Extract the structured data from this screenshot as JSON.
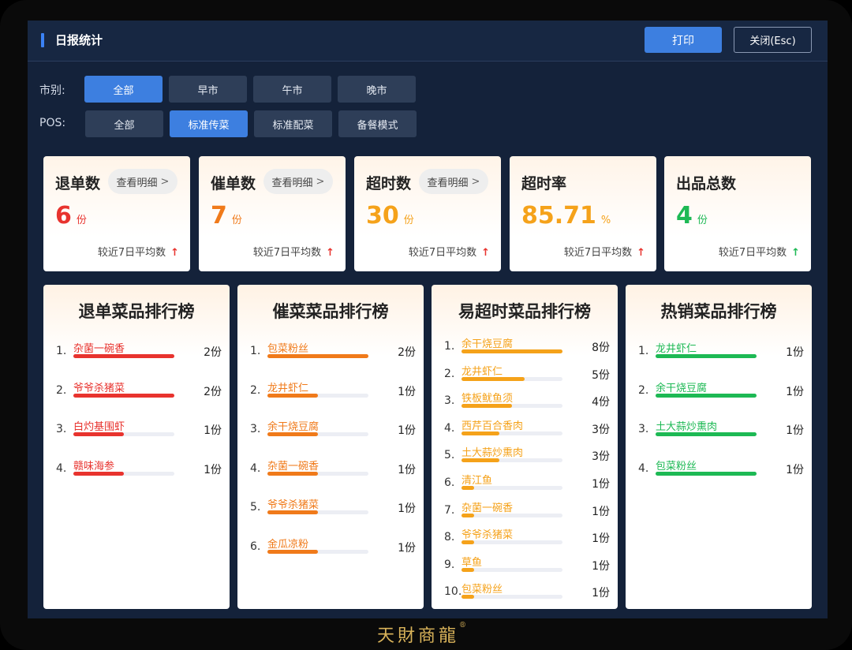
{
  "header": {
    "title": "日报统计",
    "print_label": "打印",
    "close_label": "关闭(Esc)"
  },
  "filters": {
    "market": {
      "label": "市别:",
      "options": [
        "全部",
        "早市",
        "午市",
        "晚市"
      ],
      "selected": 0
    },
    "pos": {
      "label": "POS:",
      "options": [
        "全部",
        "标准传菜",
        "标准配菜",
        "备餐模式"
      ],
      "selected": 1
    }
  },
  "stats": [
    {
      "title": "退单数",
      "detail": "查看明细",
      "value": "6",
      "unit": "份",
      "color": "#e8332e",
      "foot": "较近7日平均数",
      "trend": "up",
      "trend_color": "#e8332e"
    },
    {
      "title": "催单数",
      "detail": "查看明细",
      "value": "7",
      "unit": "份",
      "color": "#f07a1a",
      "foot": "较近7日平均数",
      "trend": "up",
      "trend_color": "#e8332e"
    },
    {
      "title": "超时数",
      "detail": "查看明细",
      "value": "30",
      "unit": "份",
      "color": "#f5a21a",
      "foot": "较近7日平均数",
      "trend": "up",
      "trend_color": "#e8332e"
    },
    {
      "title": "超时率",
      "detail": "",
      "value": "85.71",
      "unit": "%",
      "color": "#f5a21a",
      "foot": "较近7日平均数",
      "trend": "up",
      "trend_color": "#e8332e"
    },
    {
      "title": "出品总数",
      "detail": "",
      "value": "4",
      "unit": "份",
      "color": "#1db954",
      "foot": "较近7日平均数",
      "trend": "up",
      "trend_color": "#1db954"
    }
  ],
  "rankings": [
    {
      "title": "退单菜品排行榜",
      "color": "#e8332e",
      "spacing": 49.5,
      "items": [
        {
          "rank": "1.",
          "name": "杂菌一碗香",
          "count": "2份",
          "fill": 1.0
        },
        {
          "rank": "2.",
          "name": "爷爷杀猪菜",
          "count": "2份",
          "fill": 1.0
        },
        {
          "rank": "3.",
          "name": "白灼基围虾",
          "count": "1份",
          "fill": 0.5
        },
        {
          "rank": "4.",
          "name": "赣味海参",
          "count": "1份",
          "fill": 0.5
        }
      ]
    },
    {
      "title": "催菜菜品排行榜",
      "color": "#f07a1a",
      "spacing": 49.5,
      "items": [
        {
          "rank": "1.",
          "name": "包菜粉丝",
          "count": "2份",
          "fill": 1.0
        },
        {
          "rank": "2.",
          "name": "龙井虾仁",
          "count": "1份",
          "fill": 0.5
        },
        {
          "rank": "3.",
          "name": "余干烧豆腐",
          "count": "1份",
          "fill": 0.5
        },
        {
          "rank": "4.",
          "name": "杂菌一碗香",
          "count": "1份",
          "fill": 0.5
        },
        {
          "rank": "5.",
          "name": "爷爷杀猪菜",
          "count": "1份",
          "fill": 0.5
        },
        {
          "rank": "6.",
          "name": "金瓜凉粉",
          "count": "1份",
          "fill": 0.5
        }
      ]
    },
    {
      "title": "易超时菜品排行榜",
      "color": "#f5a21a",
      "spacing": 34.6,
      "items": [
        {
          "rank": "1.",
          "name": "余干烧豆腐",
          "count": "8份",
          "fill": 1.0
        },
        {
          "rank": "2.",
          "name": "龙井虾仁",
          "count": "5份",
          "fill": 0.625
        },
        {
          "rank": "3.",
          "name": "铁板鱿鱼须",
          "count": "4份",
          "fill": 0.5
        },
        {
          "rank": "4.",
          "name": "西芹百合香肉",
          "count": "3份",
          "fill": 0.375
        },
        {
          "rank": "5.",
          "name": "土大蒜炒熏肉",
          "count": "3份",
          "fill": 0.375
        },
        {
          "rank": "6.",
          "name": "清江鱼",
          "count": "1份",
          "fill": 0.125
        },
        {
          "rank": "7.",
          "name": "杂菌一碗香",
          "count": "1份",
          "fill": 0.125
        },
        {
          "rank": "8.",
          "name": "爷爷杀猪菜",
          "count": "1份",
          "fill": 0.125
        },
        {
          "rank": "9.",
          "name": "草鱼",
          "count": "1份",
          "fill": 0.125
        },
        {
          "rank": "10.",
          "name": "包菜粉丝",
          "count": "1份",
          "fill": 0.125
        }
      ]
    },
    {
      "title": "热销菜品排行榜",
      "color": "#1db954",
      "spacing": 49.5,
      "items": [
        {
          "rank": "1.",
          "name": "龙井虾仁",
          "count": "1份",
          "fill": 1.0
        },
        {
          "rank": "2.",
          "name": "余干烧豆腐",
          "count": "1份",
          "fill": 1.0
        },
        {
          "rank": "3.",
          "name": "土大蒜炒熏肉",
          "count": "1份",
          "fill": 1.0
        },
        {
          "rank": "4.",
          "name": "包菜粉丝",
          "count": "1份",
          "fill": 1.0
        }
      ]
    }
  ],
  "brand": {
    "logo": "天財商龍",
    "mark": "®"
  }
}
